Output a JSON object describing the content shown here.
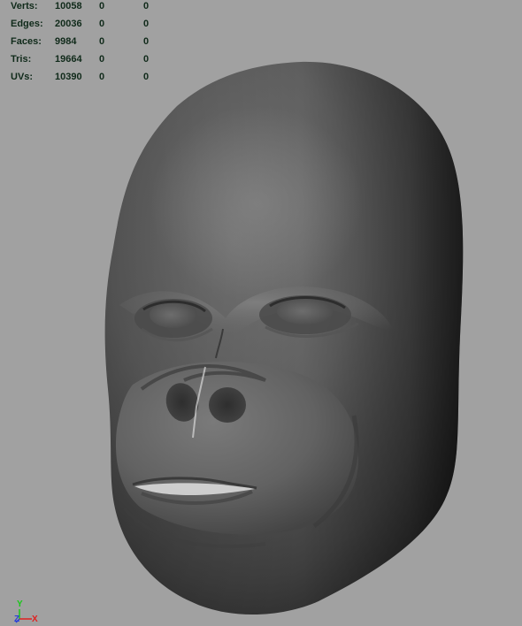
{
  "viewport": {
    "background": "#a1a1a1",
    "model_name": "gorilla-head-mesh"
  },
  "hud": {
    "rows": [
      {
        "label": "Verts:",
        "v1": "10058",
        "v2": "0",
        "v3": "0"
      },
      {
        "label": "Edges:",
        "v1": "20036",
        "v2": "0",
        "v3": "0"
      },
      {
        "label": "Faces:",
        "v1": "9984",
        "v2": "0",
        "v3": "0"
      },
      {
        "label": "Tris:",
        "v1": "19664",
        "v2": "0",
        "v3": "0"
      },
      {
        "label": "UVs:",
        "v1": "10390",
        "v2": "0",
        "v3": "0"
      }
    ]
  },
  "axis": {
    "y": "Y",
    "z": "Z",
    "x": "X",
    "colors": {
      "y": "#19c819",
      "z": "#2a3fd8",
      "x": "#e02020"
    }
  }
}
